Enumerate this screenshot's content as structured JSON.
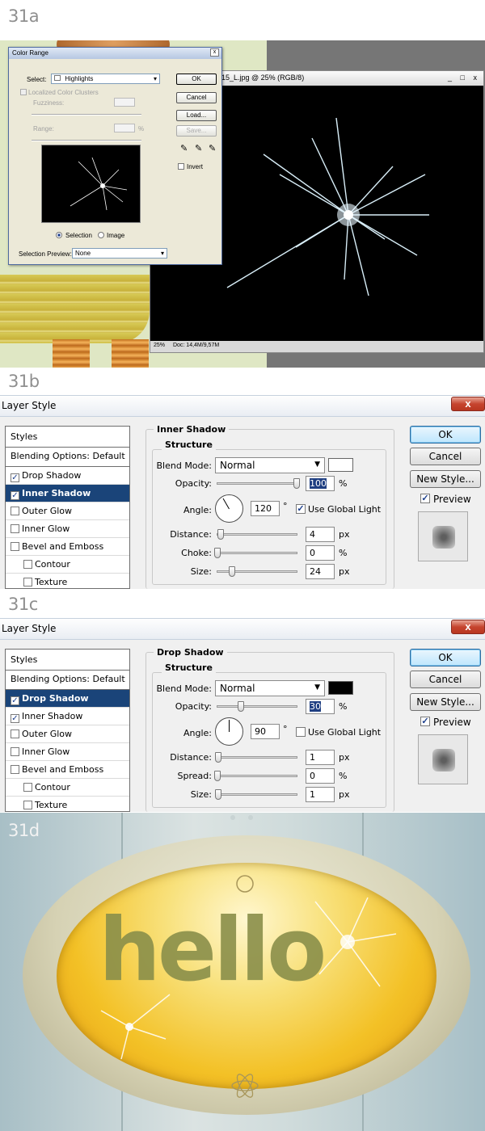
{
  "labels": {
    "a": "31a",
    "b": "31b",
    "c": "31c",
    "d": "31d"
  },
  "color_range": {
    "title": "Color Range",
    "close": "x",
    "select_label": "Select:",
    "select_value": "Highlights",
    "localized_label": "Localized Color Clusters",
    "fuzziness_label": "Fuzziness:",
    "range_label": "Range:",
    "range_unit": "%",
    "ok": "OK",
    "cancel": "Cancel",
    "load": "Load...",
    "save": "Save...",
    "invert": "Invert",
    "radio_selection": "Selection",
    "radio_image": "Image",
    "preview_label": "Selection Preview:",
    "preview_value": "None"
  },
  "ps_document": {
    "title": "15_L.jpg @ 25% (RGB/8)",
    "win_buttons": "_ □ x",
    "zoom": "25%",
    "doc_info": "Doc: 14,4M/9,57M"
  },
  "inner_shadow": {
    "window_title": "Layer Style",
    "close": "x",
    "section_title": "Inner Shadow",
    "structure": "Structure",
    "blend_mode_label": "Blend Mode:",
    "blend_mode": "Normal",
    "swatch_color": "#ffffff",
    "opacity_label": "Opacity:",
    "opacity": "100",
    "opacity_pct": 100,
    "angle_label": "Angle:",
    "angle": "120",
    "angle_deg": 120,
    "angle_unit": "°",
    "global_light": "Use Global Light",
    "distance_label": "Distance:",
    "distance": "4",
    "choke_label": "Choke:",
    "choke": "0",
    "size_label": "Size:",
    "size": "24",
    "px": "px",
    "pct": "%",
    "ok": "OK",
    "cancel": "Cancel",
    "new_style": "New Style...",
    "preview": "Preview",
    "styles": [
      "Styles",
      "Blending Options: Default",
      "Drop Shadow",
      "Inner Shadow",
      "Outer Glow",
      "Inner Glow",
      "Bevel and Emboss",
      "Contour",
      "Texture"
    ]
  },
  "drop_shadow": {
    "window_title": "Layer Style",
    "close": "x",
    "section_title": "Drop Shadow",
    "structure": "Structure",
    "blend_mode_label": "Blend Mode:",
    "blend_mode": "Normal",
    "swatch_color": "#000000",
    "opacity_label": "Opacity:",
    "opacity": "30",
    "opacity_pct": 30,
    "angle_label": "Angle:",
    "angle": "90",
    "angle_deg": 90,
    "angle_unit": "°",
    "global_light": "Use Global Light",
    "distance_label": "Distance:",
    "distance": "1",
    "spread_label": "Spread:",
    "spread": "0",
    "size_label": "Size:",
    "size": "1",
    "px": "px",
    "pct": "%",
    "ok": "OK",
    "cancel": "Cancel",
    "new_style": "New Style...",
    "preview": "Preview",
    "styles": [
      "Styles",
      "Blending Options: Default",
      "Drop Shadow",
      "Inner Shadow",
      "Outer Glow",
      "Inner Glow",
      "Bevel and Emboss",
      "Contour",
      "Texture"
    ]
  },
  "artwork": {
    "text": "hello"
  }
}
